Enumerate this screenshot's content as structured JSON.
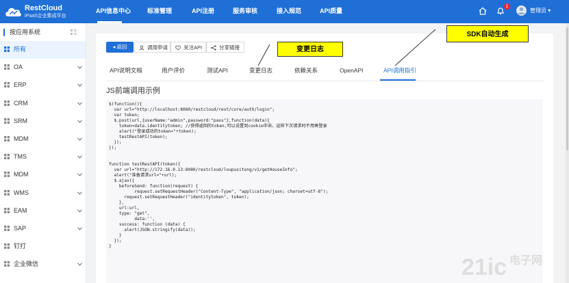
{
  "app": {
    "name": "RestCloud",
    "subtitle": "iPaaS企业集成平台"
  },
  "nav": [
    "API信息中心",
    "标准管理",
    "API注册",
    "服务审核",
    "接入规范",
    "API质量"
  ],
  "header": {
    "badge": "1",
    "user": "管理员 ▾"
  },
  "sidebar": {
    "title": "按应用系统",
    "items": [
      {
        "label": "所有",
        "chevron": false
      },
      {
        "label": "OA",
        "chevron": true
      },
      {
        "label": "ERP",
        "chevron": true
      },
      {
        "label": "CRM",
        "chevron": true
      },
      {
        "label": "SRM",
        "chevron": true
      },
      {
        "label": "MDM",
        "chevron": true
      },
      {
        "label": "TMS",
        "chevron": true
      },
      {
        "label": "MDM",
        "chevron": true
      },
      {
        "label": "WMS",
        "chevron": true
      },
      {
        "label": "EAM",
        "chevron": true
      },
      {
        "label": "SAP",
        "chevron": true
      },
      {
        "label": "钉打",
        "chevron": false
      },
      {
        "label": "企业微信",
        "chevron": true
      }
    ]
  },
  "toolbar": {
    "back": "返回",
    "apply": "调用申请",
    "follow": "关注API",
    "share": "分享链接"
  },
  "tabs": [
    "API说明文档",
    "用户评价",
    "测试API",
    "变更日志",
    "依赖关系",
    "OpenAPI",
    "API调用指引"
  ],
  "section_title": "JS前端调用示例",
  "code_lines": [
    "$(function(){",
    "  var url=\"http://localhost:8080/restcloud/rest/core/auth/login\";",
    "  var token;",
    "  $.post(url,{userName:\"admin\",password:\"pass\"},function(data){",
    "    token=data.identitytoken; //获得返回的token,可以设置到cookie中去，这样下次请求时不用再登录",
    "    alert(\"登录成功的token=\"+token);",
    "    testRestAPI(token);",
    "  });",
    "});",
    "",
    "",
    "function testRestAPI(token){",
    "  var url=\"http://172.16.0.13:8080/restcloud/loupusitong/v1/getHouseInfo\";",
    "  alert(\"准备请求url=\"+url);",
    "  $.ajax({",
    "    beforeSend: function(request) {",
    "          request.setRequestHeader(\"Content-Type\", \"application/json; charset=utf-8\");",
    "      request.setRequestHeader(\"identitytoken\", token);",
    "    },",
    "    url:url,",
    "    type: \"get\",",
    "          data:'',",
    "    success: function (data) {",
    "      alert(JSON.stringify(data));",
    "    }",
    "  });",
    "}"
  ],
  "annotations": {
    "changelog": "变更日志",
    "sdk": "SDK自动生成"
  },
  "watermark": {
    "brand": "21ic",
    "cn": "电子网"
  },
  "colors": {
    "primary": "#1f6fd6",
    "callout": "#ffff00",
    "background": "#f2f3f5"
  }
}
